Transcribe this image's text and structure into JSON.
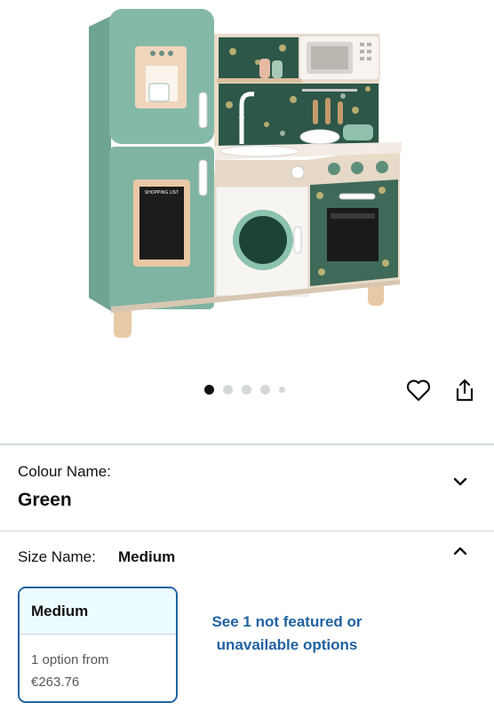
{
  "product": {
    "image_alt_label": "SHOPPING LIST",
    "carousel": {
      "count": 5,
      "active_index": 0
    }
  },
  "actions": {
    "wishlist_icon": "heart-icon",
    "share_icon": "share-icon"
  },
  "colour": {
    "label": "Colour Name:",
    "value": "Green",
    "chevron_icon": "chevron-down-icon"
  },
  "size": {
    "label": "Size Name:",
    "value": "Medium",
    "chevron_icon": "chevron-up-icon",
    "options": [
      {
        "name": "Medium",
        "availability": "1 option from",
        "price": "€263.76"
      }
    ],
    "unavailable_link": "See 1 not featured or unavailable options"
  },
  "colors": {
    "link": "#2162a1",
    "selected_border": "#2162a1",
    "card_header_bg": "#edfdff",
    "kitchen_green": "#7fb5a4"
  }
}
